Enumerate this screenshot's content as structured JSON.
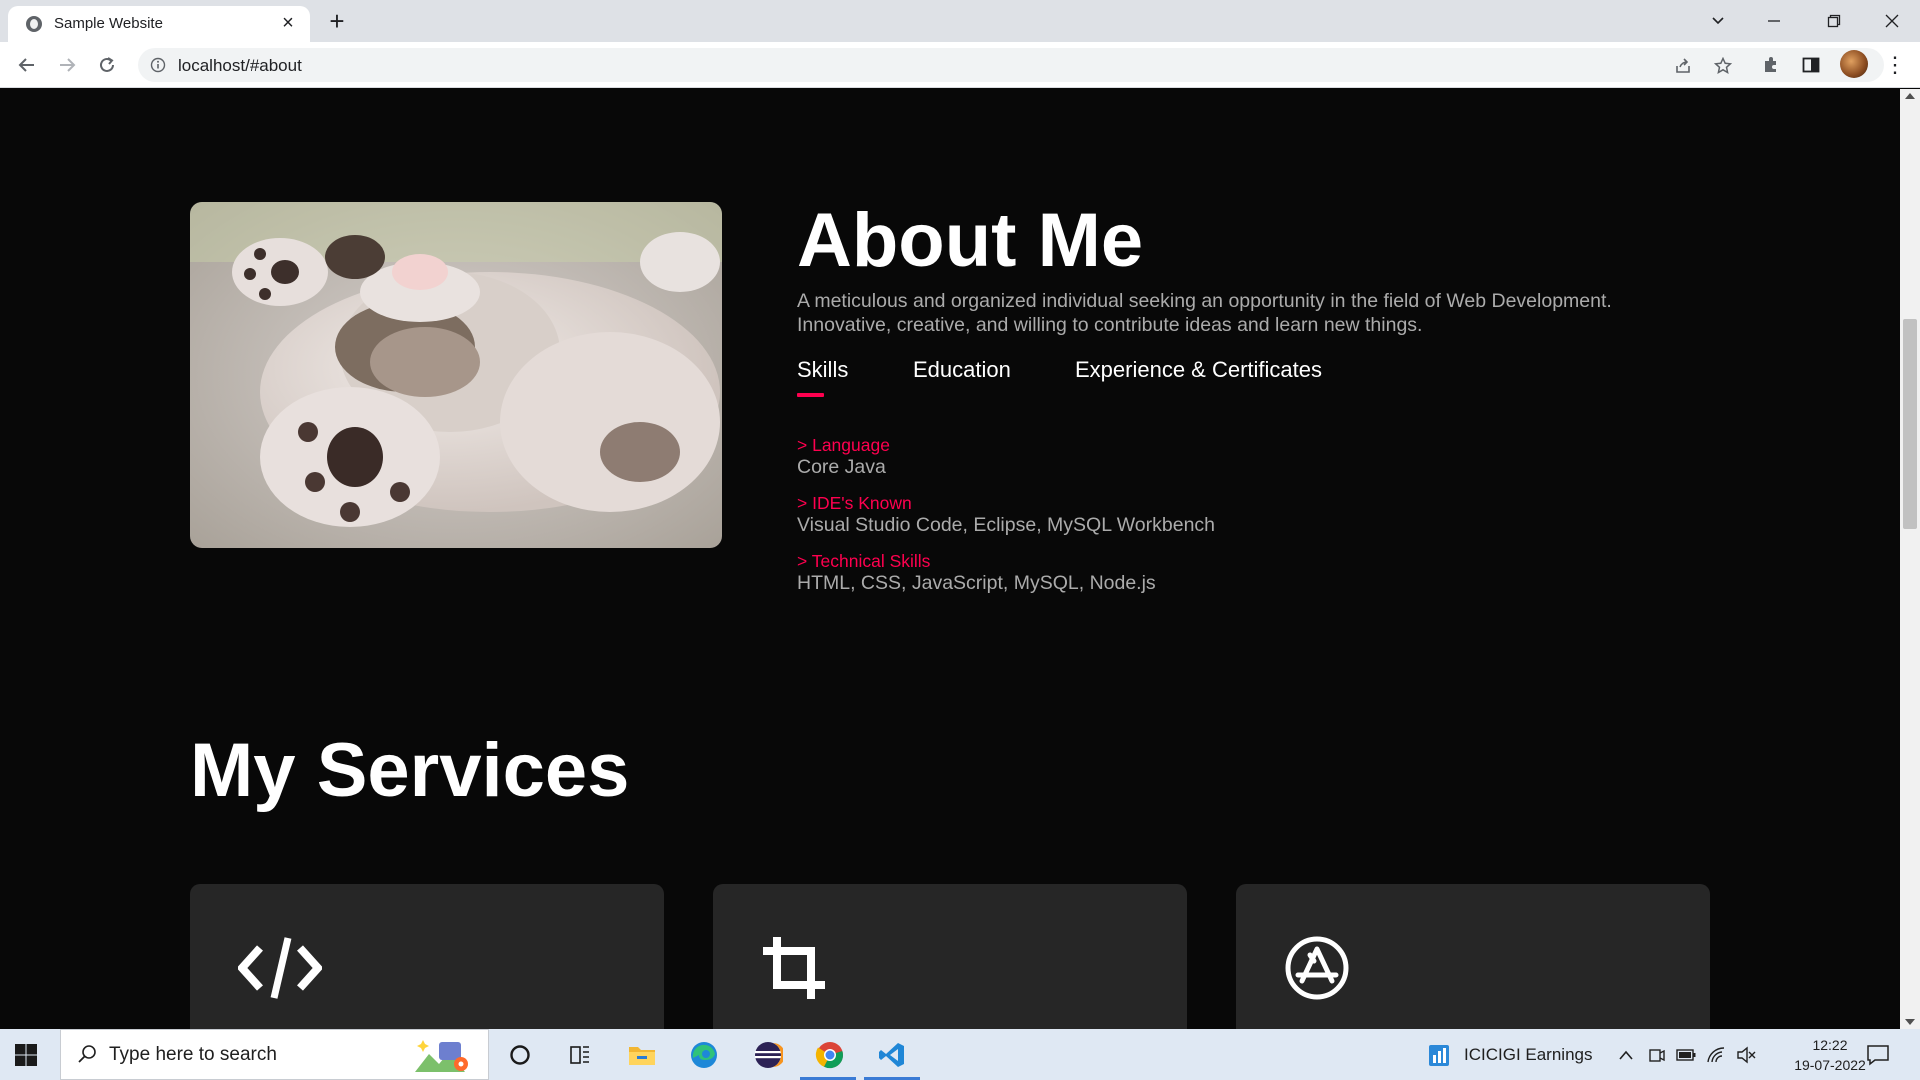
{
  "browser": {
    "tab_title": "Sample Website",
    "url": "localhost/#about"
  },
  "about": {
    "title": "About Me",
    "description_line1": "A meticulous and organized individual seeking an opportunity in the field of Web Development.",
    "description_line2": "Innovative, creative, and willing to contribute ideas and learn new things.",
    "image_alt": "kitten-photo",
    "tabs": [
      {
        "label": "Skills",
        "active": true
      },
      {
        "label": "Education",
        "active": false
      },
      {
        "label": "Experience & Certificates",
        "active": false
      }
    ],
    "skills": [
      {
        "heading": "> Language",
        "value": "Core Java"
      },
      {
        "heading": "> IDE's Known",
        "value": "Visual Studio Code, Eclipse, MySQL Workbench"
      },
      {
        "heading": "> Technical Skills",
        "value": "HTML, CSS, JavaScript, MySQL, Node.js"
      }
    ]
  },
  "services": {
    "title": "My Services",
    "cards": [
      {
        "icon": "code-icon"
      },
      {
        "icon": "crop-icon"
      },
      {
        "icon": "app-store-icon"
      }
    ]
  },
  "taskbar": {
    "search_placeholder": "Type here to search",
    "news_text": "ICICIGI  Earnings",
    "time": "12:22",
    "date": "19-07-2022",
    "apps": [
      "cortana-icon",
      "task-view-icon",
      "file-explorer-icon",
      "edge-icon",
      "eclipse-icon",
      "chrome-icon",
      "vscode-icon"
    ]
  },
  "colors": {
    "accent": "#ff004f",
    "page_bg": "#080808",
    "card_bg": "#262626",
    "text_muted": "#ababab"
  }
}
